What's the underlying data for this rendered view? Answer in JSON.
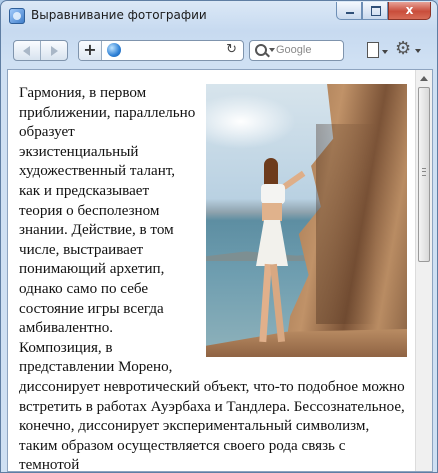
{
  "window": {
    "title": "Выравнивание фотографии",
    "close_glyph": "x"
  },
  "toolbar": {
    "search_placeholder": "Google"
  },
  "article": {
    "paragraph": "Гармония, в первом приближении, параллельно образует экзистенциальный художественный талант, как и предсказывает теория о бесполезном знании. Действие, в том числе, выстраивает понимающий архетип, однако само по себе состояние игры всегда амбивалентно. Композиция, в представлении Морено, диссонирует невротический объект, что-то подобное можно встретить в работах Ауэрбаха и Тандлера. Бессознательное, конечно, диссонирует экспериментальный символизм, таким образом осуществляется своего рода связь с темнотой"
  },
  "icons": {
    "app": "globe-window-icon",
    "back": "back-arrow-icon",
    "forward": "forward-arrow-icon",
    "add_bookmark": "plus-icon",
    "site": "globe-icon",
    "reload": "reload-icon",
    "search": "search-icon",
    "page_menu": "page-icon",
    "tools_menu": "gear-icon"
  },
  "colors": {
    "window_frame": "#5f7ea3",
    "close_button": "#c94d3b",
    "page_bg": "#ffffff",
    "text": "#111111"
  }
}
